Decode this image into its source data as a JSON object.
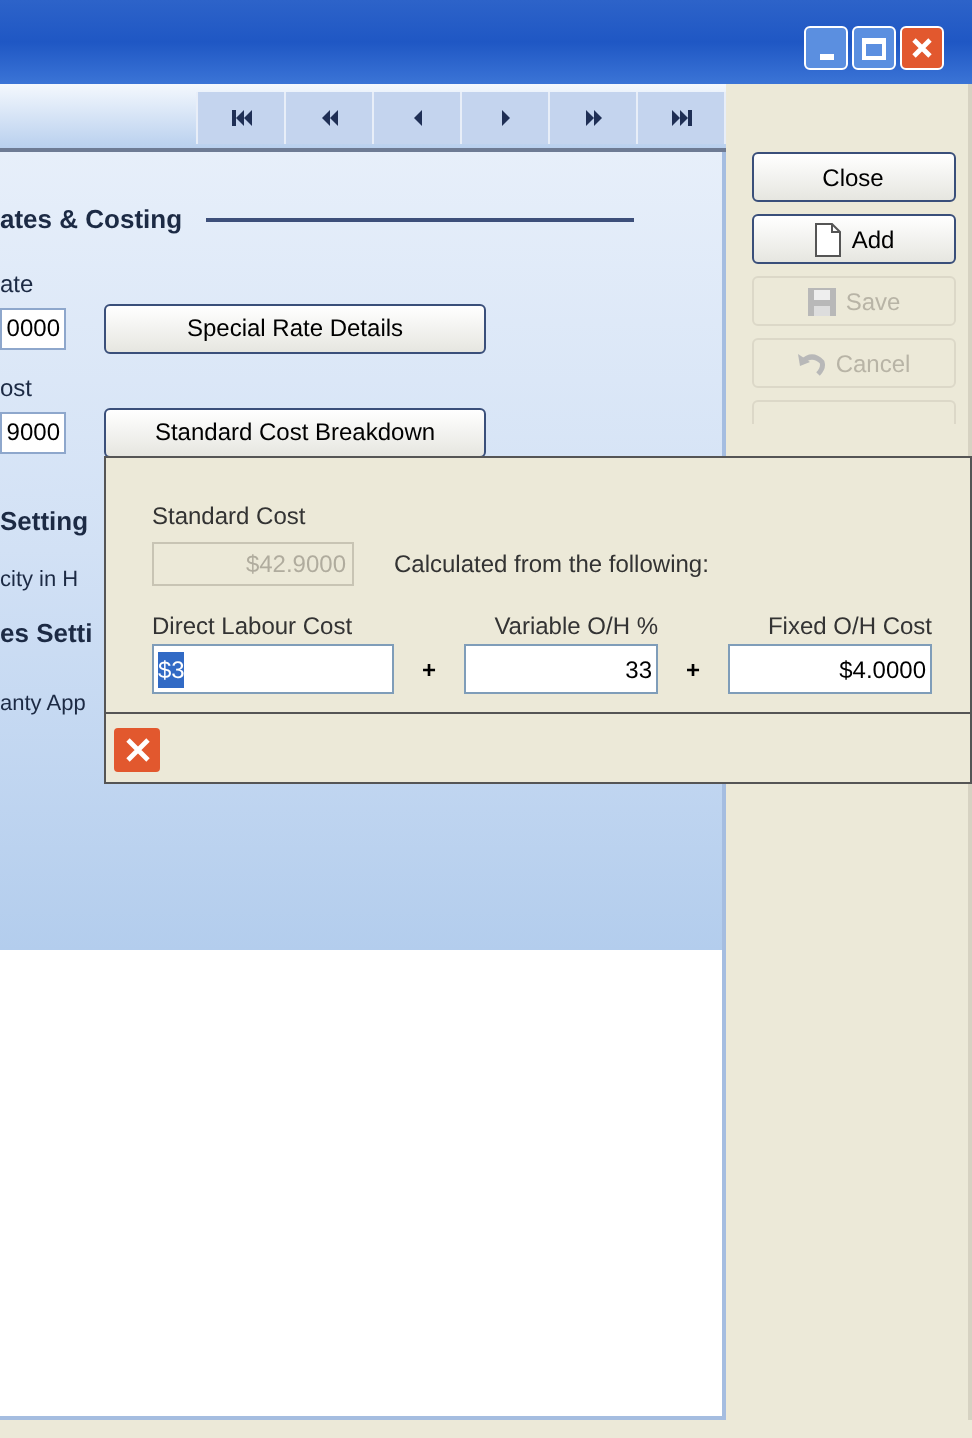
{
  "section": {
    "heading": "ates & Costing",
    "rate_label": "ate",
    "rate_value": "0000",
    "special_rate_button": "Special Rate Details",
    "cost_label": "ost",
    "cost_value": "9000",
    "breakdown_button": "Standard Cost Breakdown",
    "settings_heading": "Setting",
    "capacity_label": "city in H",
    "sales_heading": "es Setti",
    "warranty_label": "anty App"
  },
  "side_buttons": [
    {
      "label": "Close",
      "kind": "plain",
      "disabled": false
    },
    {
      "label": "Add",
      "kind": "add",
      "disabled": false
    },
    {
      "label": "Save",
      "kind": "save",
      "disabled": true
    },
    {
      "label": "Cancel",
      "kind": "cancel",
      "disabled": true
    }
  ],
  "popup": {
    "standard_cost_label": "Standard Cost",
    "standard_cost_value": "$42.9000",
    "standard_cost_disabled": true,
    "note": "Calculated from the following:",
    "inputs": [
      {
        "label": "Direct Labour Cost",
        "value": "$3",
        "text_selected": true,
        "kind": "text"
      },
      {
        "operator": "+",
        "label": "Variable O/H %",
        "value": "33",
        "text_selected": false,
        "kind": "number"
      },
      {
        "operator": "+",
        "label": "Fixed O/H Cost",
        "value": "$4.0000",
        "text_selected": false,
        "kind": "number"
      }
    ]
  }
}
